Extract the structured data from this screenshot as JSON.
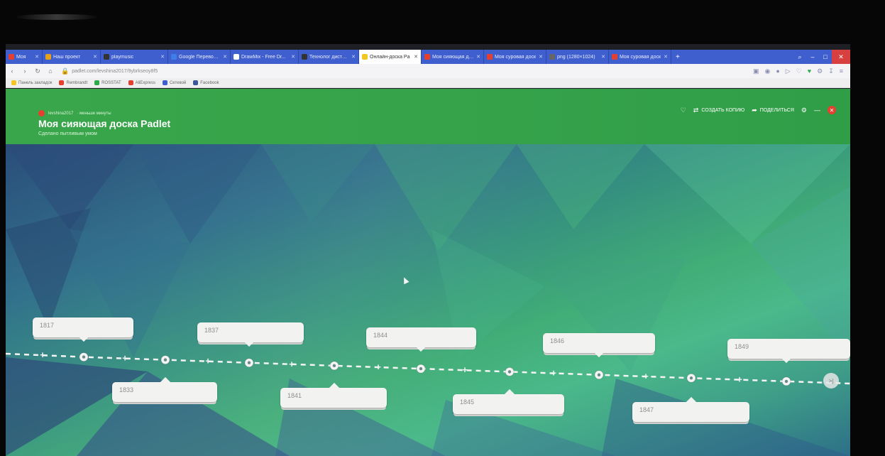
{
  "browser": {
    "tabs": [
      {
        "label": "Моя",
        "color": "#e5402f",
        "active": false
      },
      {
        "label": "Наш проект",
        "color": "#e8a21a",
        "active": false
      },
      {
        "label": "playmusic",
        "color": "#333333",
        "active": false
      },
      {
        "label": "Google Переводчик",
        "color": "#3f7ee8",
        "active": false
      },
      {
        "label": "DrawMix - Free Dr...",
        "color": "#ffffff",
        "active": false
      },
      {
        "label": "Технолог дистанц",
        "color": "#333333",
        "active": false
      },
      {
        "label": "Онлайн-доска Pa",
        "color": "#f3c623",
        "active": true
      },
      {
        "label": "Моя сияющая доск",
        "color": "#e5402f",
        "active": false
      },
      {
        "label": "Моя суровая доск",
        "color": "#e5402f",
        "active": false
      },
      {
        "label": "png (1280×1024)",
        "color": "#666666",
        "active": false
      },
      {
        "label": "Моя суровая доск",
        "color": "#e5402f",
        "active": false
      }
    ],
    "url": "padlet.com/levshina2017/9ybrkseoy8f5",
    "bookmarks": [
      {
        "label": "Панель закладок",
        "color": "#f3c623"
      },
      {
        "label": "Rembrandt",
        "color": "#e5402f"
      },
      {
        "label": "ROSSTAT",
        "color": "#2eaa4b"
      },
      {
        "label": "AliExpress",
        "color": "#e5402f"
      },
      {
        "label": "Сетевой",
        "color": "#3f5fcf"
      },
      {
        "label": "Facebook",
        "color": "#3b5998"
      }
    ]
  },
  "board": {
    "author": "levshina2017",
    "meta": "· меньше минуты",
    "title": "Моя сияющая доска Padlet",
    "subtitle": "Сделано пытливым умом",
    "actions": {
      "remake": "СОЗДАТЬ КОПИЮ",
      "share": "ПОДЕЛИТЬСЯ"
    }
  },
  "timeline": {
    "cards": [
      "1817",
      "1833",
      "1837",
      "1841",
      "1844",
      "1845",
      "1846",
      "1847",
      "1849"
    ],
    "end_button": ">|"
  }
}
